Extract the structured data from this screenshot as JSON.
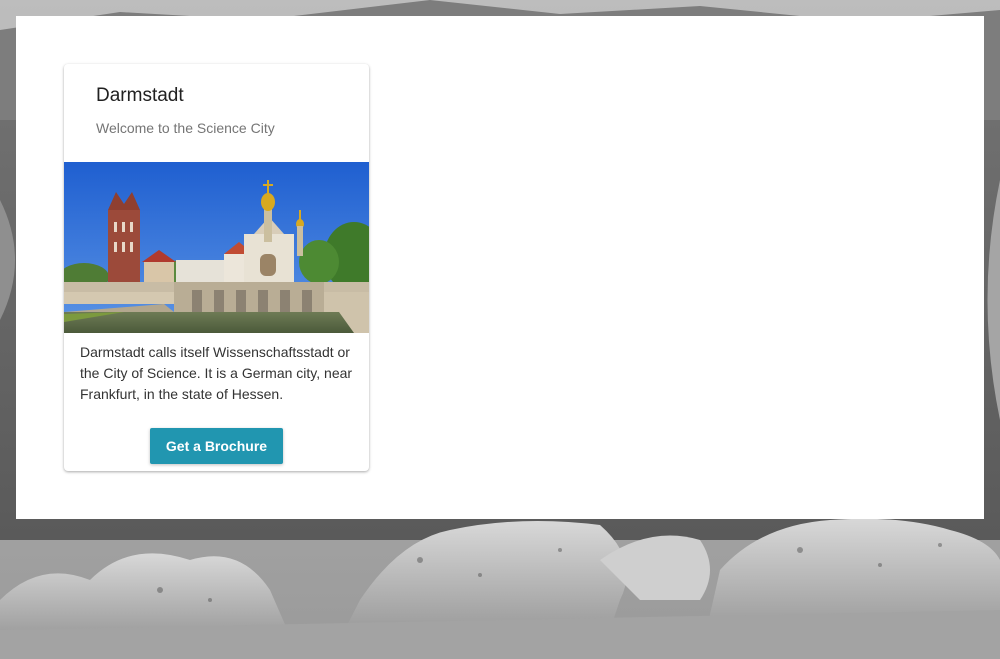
{
  "card": {
    "title": "Darmstadt",
    "subtitle": "Welcome to the Science City",
    "image_alt": "Mathildenhöhe with Wedding Tower and Russian Chapel",
    "body": "Darmstadt calls itself Wissenschaftsstadt or the City of Science. It is a German city, near Frankfurt, in the state of Hessen.",
    "button_label": "Get a Brochure"
  },
  "colors": {
    "button": "#2196b0",
    "panel": "#ffffff"
  }
}
